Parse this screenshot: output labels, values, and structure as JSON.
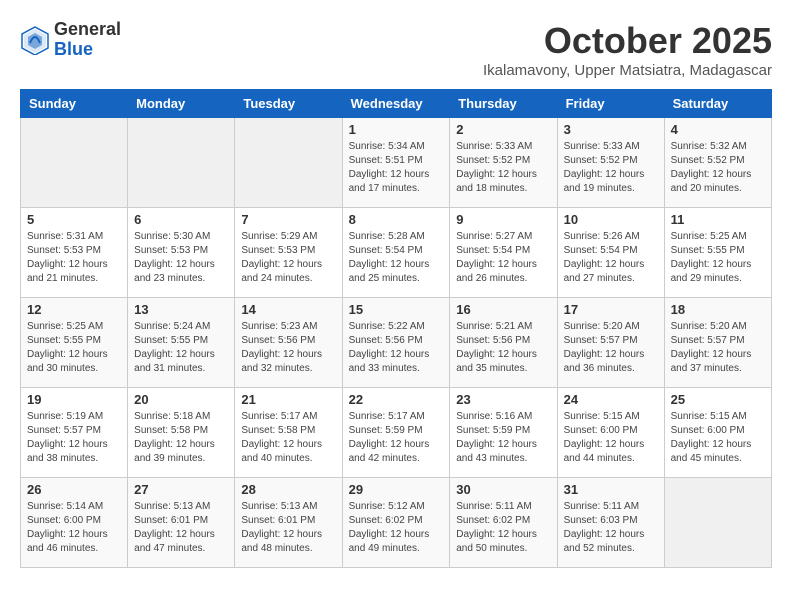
{
  "logo": {
    "general": "General",
    "blue": "Blue"
  },
  "header": {
    "month": "October 2025",
    "location": "Ikalamavony, Upper Matsiatra, Madagascar"
  },
  "weekdays": [
    "Sunday",
    "Monday",
    "Tuesday",
    "Wednesday",
    "Thursday",
    "Friday",
    "Saturday"
  ],
  "weeks": [
    [
      {
        "day": "",
        "sunrise": "",
        "sunset": "",
        "daylight": ""
      },
      {
        "day": "",
        "sunrise": "",
        "sunset": "",
        "daylight": ""
      },
      {
        "day": "",
        "sunrise": "",
        "sunset": "",
        "daylight": ""
      },
      {
        "day": "1",
        "sunrise": "Sunrise: 5:34 AM",
        "sunset": "Sunset: 5:51 PM",
        "daylight": "Daylight: 12 hours and 17 minutes."
      },
      {
        "day": "2",
        "sunrise": "Sunrise: 5:33 AM",
        "sunset": "Sunset: 5:52 PM",
        "daylight": "Daylight: 12 hours and 18 minutes."
      },
      {
        "day": "3",
        "sunrise": "Sunrise: 5:33 AM",
        "sunset": "Sunset: 5:52 PM",
        "daylight": "Daylight: 12 hours and 19 minutes."
      },
      {
        "day": "4",
        "sunrise": "Sunrise: 5:32 AM",
        "sunset": "Sunset: 5:52 PM",
        "daylight": "Daylight: 12 hours and 20 minutes."
      }
    ],
    [
      {
        "day": "5",
        "sunrise": "Sunrise: 5:31 AM",
        "sunset": "Sunset: 5:53 PM",
        "daylight": "Daylight: 12 hours and 21 minutes."
      },
      {
        "day": "6",
        "sunrise": "Sunrise: 5:30 AM",
        "sunset": "Sunset: 5:53 PM",
        "daylight": "Daylight: 12 hours and 23 minutes."
      },
      {
        "day": "7",
        "sunrise": "Sunrise: 5:29 AM",
        "sunset": "Sunset: 5:53 PM",
        "daylight": "Daylight: 12 hours and 24 minutes."
      },
      {
        "day": "8",
        "sunrise": "Sunrise: 5:28 AM",
        "sunset": "Sunset: 5:54 PM",
        "daylight": "Daylight: 12 hours and 25 minutes."
      },
      {
        "day": "9",
        "sunrise": "Sunrise: 5:27 AM",
        "sunset": "Sunset: 5:54 PM",
        "daylight": "Daylight: 12 hours and 26 minutes."
      },
      {
        "day": "10",
        "sunrise": "Sunrise: 5:26 AM",
        "sunset": "Sunset: 5:54 PM",
        "daylight": "Daylight: 12 hours and 27 minutes."
      },
      {
        "day": "11",
        "sunrise": "Sunrise: 5:25 AM",
        "sunset": "Sunset: 5:55 PM",
        "daylight": "Daylight: 12 hours and 29 minutes."
      }
    ],
    [
      {
        "day": "12",
        "sunrise": "Sunrise: 5:25 AM",
        "sunset": "Sunset: 5:55 PM",
        "daylight": "Daylight: 12 hours and 30 minutes."
      },
      {
        "day": "13",
        "sunrise": "Sunrise: 5:24 AM",
        "sunset": "Sunset: 5:55 PM",
        "daylight": "Daylight: 12 hours and 31 minutes."
      },
      {
        "day": "14",
        "sunrise": "Sunrise: 5:23 AM",
        "sunset": "Sunset: 5:56 PM",
        "daylight": "Daylight: 12 hours and 32 minutes."
      },
      {
        "day": "15",
        "sunrise": "Sunrise: 5:22 AM",
        "sunset": "Sunset: 5:56 PM",
        "daylight": "Daylight: 12 hours and 33 minutes."
      },
      {
        "day": "16",
        "sunrise": "Sunrise: 5:21 AM",
        "sunset": "Sunset: 5:56 PM",
        "daylight": "Daylight: 12 hours and 35 minutes."
      },
      {
        "day": "17",
        "sunrise": "Sunrise: 5:20 AM",
        "sunset": "Sunset: 5:57 PM",
        "daylight": "Daylight: 12 hours and 36 minutes."
      },
      {
        "day": "18",
        "sunrise": "Sunrise: 5:20 AM",
        "sunset": "Sunset: 5:57 PM",
        "daylight": "Daylight: 12 hours and 37 minutes."
      }
    ],
    [
      {
        "day": "19",
        "sunrise": "Sunrise: 5:19 AM",
        "sunset": "Sunset: 5:57 PM",
        "daylight": "Daylight: 12 hours and 38 minutes."
      },
      {
        "day": "20",
        "sunrise": "Sunrise: 5:18 AM",
        "sunset": "Sunset: 5:58 PM",
        "daylight": "Daylight: 12 hours and 39 minutes."
      },
      {
        "day": "21",
        "sunrise": "Sunrise: 5:17 AM",
        "sunset": "Sunset: 5:58 PM",
        "daylight": "Daylight: 12 hours and 40 minutes."
      },
      {
        "day": "22",
        "sunrise": "Sunrise: 5:17 AM",
        "sunset": "Sunset: 5:59 PM",
        "daylight": "Daylight: 12 hours and 42 minutes."
      },
      {
        "day": "23",
        "sunrise": "Sunrise: 5:16 AM",
        "sunset": "Sunset: 5:59 PM",
        "daylight": "Daylight: 12 hours and 43 minutes."
      },
      {
        "day": "24",
        "sunrise": "Sunrise: 5:15 AM",
        "sunset": "Sunset: 6:00 PM",
        "daylight": "Daylight: 12 hours and 44 minutes."
      },
      {
        "day": "25",
        "sunrise": "Sunrise: 5:15 AM",
        "sunset": "Sunset: 6:00 PM",
        "daylight": "Daylight: 12 hours and 45 minutes."
      }
    ],
    [
      {
        "day": "26",
        "sunrise": "Sunrise: 5:14 AM",
        "sunset": "Sunset: 6:00 PM",
        "daylight": "Daylight: 12 hours and 46 minutes."
      },
      {
        "day": "27",
        "sunrise": "Sunrise: 5:13 AM",
        "sunset": "Sunset: 6:01 PM",
        "daylight": "Daylight: 12 hours and 47 minutes."
      },
      {
        "day": "28",
        "sunrise": "Sunrise: 5:13 AM",
        "sunset": "Sunset: 6:01 PM",
        "daylight": "Daylight: 12 hours and 48 minutes."
      },
      {
        "day": "29",
        "sunrise": "Sunrise: 5:12 AM",
        "sunset": "Sunset: 6:02 PM",
        "daylight": "Daylight: 12 hours and 49 minutes."
      },
      {
        "day": "30",
        "sunrise": "Sunrise: 5:11 AM",
        "sunset": "Sunset: 6:02 PM",
        "daylight": "Daylight: 12 hours and 50 minutes."
      },
      {
        "day": "31",
        "sunrise": "Sunrise: 5:11 AM",
        "sunset": "Sunset: 6:03 PM",
        "daylight": "Daylight: 12 hours and 52 minutes."
      },
      {
        "day": "",
        "sunrise": "",
        "sunset": "",
        "daylight": ""
      }
    ]
  ]
}
